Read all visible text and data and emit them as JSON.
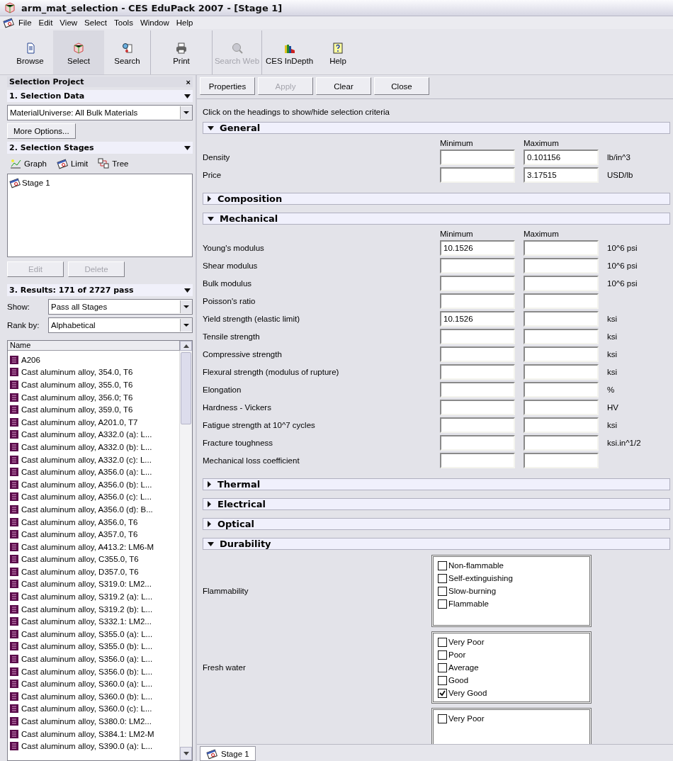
{
  "window": {
    "title": "arm_mat_selection - CES EduPack 2007 - [Stage 1]"
  },
  "menu": [
    "File",
    "Edit",
    "View",
    "Select",
    "Tools",
    "Window",
    "Help"
  ],
  "toolbar": [
    {
      "label": "Browse",
      "selected": false,
      "disabled": false
    },
    {
      "label": "Select",
      "selected": true,
      "disabled": false
    },
    {
      "label": "Search",
      "selected": false,
      "disabled": false
    },
    {
      "label": "Print",
      "selected": false,
      "disabled": false
    },
    {
      "label": "Search Web",
      "selected": false,
      "disabled": true
    },
    {
      "label": "CES InDepth",
      "selected": false,
      "disabled": false
    },
    {
      "label": "Help",
      "selected": false,
      "disabled": false
    }
  ],
  "sidebar": {
    "title": "Selection Project",
    "close": "×",
    "selection_data": {
      "heading": "1. Selection Data",
      "database": "MaterialUniverse: All Bulk Materials",
      "more_options": "More Options..."
    },
    "selection_stages": {
      "heading": "2. Selection Stages",
      "tools": [
        "Graph",
        "Limit",
        "Tree"
      ],
      "stages": [
        {
          "label": "Stage 1",
          "selected": false
        }
      ],
      "buttons": [
        {
          "label": "Edit",
          "disabled": true
        },
        {
          "label": "Delete",
          "disabled": true
        }
      ]
    },
    "results": {
      "heading": "3. Results: 171 of 2727 pass",
      "show_label": "Show:",
      "show_value": "Pass all Stages",
      "rank_label": "Rank by:",
      "rank_value": "Alphabetical",
      "column": "Name",
      "items": [
        "A206",
        "Cast aluminum alloy, 354.0, T6",
        "Cast aluminum alloy, 355.0, T6",
        "Cast aluminum alloy, 356.0; T6",
        "Cast aluminum alloy, 359.0, T6",
        "Cast aluminum alloy, A201.0, T7",
        "Cast aluminum alloy, A332.0 (a): L...",
        "Cast aluminum alloy, A332.0 (b): L...",
        "Cast aluminum alloy, A332.0 (c): L...",
        "Cast aluminum alloy, A356.0 (a): L...",
        "Cast aluminum alloy, A356.0 (b): L...",
        "Cast aluminum alloy, A356.0 (c): L...",
        "Cast aluminum alloy, A356.0 (d): B...",
        "Cast aluminum alloy, A356.0, T6",
        "Cast aluminum alloy, A357.0, T6",
        "Cast aluminum alloy, A413.2: LM6-M",
        "Cast aluminum alloy, C355.0, T6",
        "Cast aluminum alloy, D357.0, T6",
        "Cast aluminum alloy, S319.0: LM2...",
        "Cast aluminum alloy, S319.2 (a): L...",
        "Cast aluminum alloy, S319.2 (b): L...",
        "Cast aluminum alloy, S332.1: LM2...",
        "Cast aluminum alloy, S355.0 (a): L...",
        "Cast aluminum alloy, S355.0 (b): L...",
        "Cast aluminum alloy, S356.0 (a): L...",
        "Cast aluminum alloy, S356.0 (b): L...",
        "Cast aluminum alloy, S360.0 (a): L...",
        "Cast aluminum alloy, S360.0 (b): L...",
        "Cast aluminum alloy, S360.0 (c): L...",
        "Cast aluminum alloy, S380.0: LM2...",
        "Cast aluminum alloy, S384.1: LM2-M",
        "Cast aluminum alloy, S390.0 (a): L..."
      ]
    }
  },
  "actions": [
    {
      "label": "Properties",
      "disabled": false
    },
    {
      "label": "Apply",
      "disabled": true
    },
    {
      "label": "Clear",
      "disabled": false
    },
    {
      "label": "Close",
      "disabled": false
    }
  ],
  "hint": "Click on the headings to show/hide selection criteria",
  "sections": [
    {
      "title": "General",
      "expanded": true,
      "kind": "range",
      "min_label": "Minimum",
      "max_label": "Maximum",
      "rows": [
        {
          "label": "Density",
          "max": "0.101156",
          "unit": "lb/in^3"
        },
        {
          "label": "Price",
          "max": "3.17515",
          "unit": "USD/lb"
        }
      ]
    },
    {
      "title": "Composition",
      "expanded": false
    },
    {
      "title": "Mechanical",
      "expanded": true,
      "kind": "range",
      "min_label": "Minimum",
      "max_label": "Maximum",
      "rows": [
        {
          "label": "Young's modulus",
          "min": "10.1526",
          "unit": "10^6 psi"
        },
        {
          "label": "Shear modulus",
          "unit": "10^6 psi"
        },
        {
          "label": "Bulk modulus",
          "unit": "10^6 psi"
        },
        {
          "label": "Poisson's ratio"
        },
        {
          "label": "Yield strength (elastic limit)",
          "min": "10.1526",
          "unit": "ksi"
        },
        {
          "label": "Tensile strength",
          "unit": "ksi"
        },
        {
          "label": "Compressive strength",
          "unit": "ksi"
        },
        {
          "label": "Flexural strength (modulus of rupture)",
          "unit": "ksi"
        },
        {
          "label": "Elongation",
          "unit": "%"
        },
        {
          "label": "Hardness - Vickers",
          "unit": "HV"
        },
        {
          "label": "Fatigue strength at 10^7 cycles",
          "unit": "ksi"
        },
        {
          "label": "Fracture toughness",
          "unit": "ksi.in^1/2"
        },
        {
          "label": "Mechanical loss coefficient"
        }
      ]
    },
    {
      "title": "Thermal",
      "expanded": false
    },
    {
      "title": "Electrical",
      "expanded": false
    },
    {
      "title": "Optical",
      "expanded": false
    },
    {
      "title": "Durability",
      "expanded": true,
      "kind": "checklist",
      "groups": [
        {
          "label": "Flammability",
          "options": [
            {
              "label": "Non-flammable",
              "checked": false
            },
            {
              "label": "Self-extinguishing",
              "checked": false
            },
            {
              "label": "Slow-burning",
              "checked": false
            },
            {
              "label": "Flammable",
              "checked": false
            }
          ]
        },
        {
          "label": "Fresh water",
          "options": [
            {
              "label": "Very Poor",
              "checked": false
            },
            {
              "label": "Poor",
              "checked": false
            },
            {
              "label": "Average",
              "checked": false
            },
            {
              "label": "Good",
              "checked": false
            },
            {
              "label": "Very Good",
              "checked": true
            }
          ]
        },
        {
          "options": [
            {
              "label": "Very Poor",
              "checked": false
            }
          ]
        }
      ]
    }
  ],
  "stage_tabs": [
    {
      "label": "Stage 1",
      "selected": true
    }
  ]
}
